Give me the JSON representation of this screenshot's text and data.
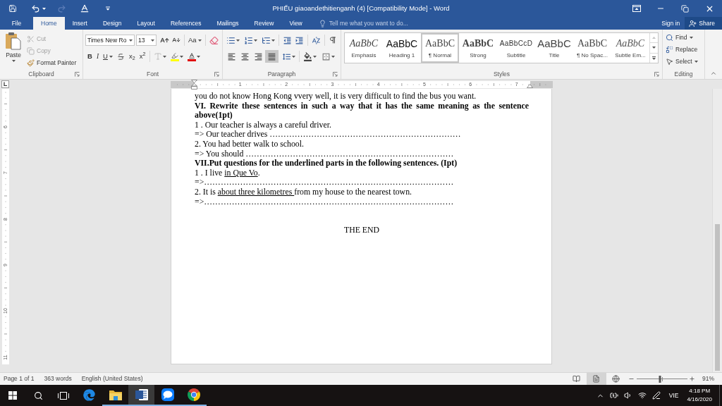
{
  "title_bar": {
    "title": "PHIẾU giaoandethitienganh (4) [Compatibility Mode] - Word",
    "quick_access": [
      {
        "kind": "save",
        "disabled": false
      },
      {
        "kind": "undo",
        "disabled": false
      },
      {
        "kind": "redo",
        "disabled": true
      },
      {
        "kind": "font_color",
        "disabled": false
      },
      {
        "kind": "customize",
        "disabled": false
      }
    ]
  },
  "tabs": [
    {
      "label": "File",
      "selected": false
    },
    {
      "label": "Home",
      "selected": true
    },
    {
      "label": "Insert",
      "selected": false
    },
    {
      "label": "Design",
      "selected": false
    },
    {
      "label": "Layout",
      "selected": false
    },
    {
      "label": "References",
      "selected": false
    },
    {
      "label": "Mailings",
      "selected": false
    },
    {
      "label": "Review",
      "selected": false
    },
    {
      "label": "View",
      "selected": false
    }
  ],
  "tell_me": {
    "placeholder": "Tell me what you want to do..."
  },
  "account": {
    "sign_in": "Sign in",
    "share": "Share"
  },
  "ribbon": {
    "clipboard": {
      "label": "Clipboard",
      "paste": "Paste",
      "items": [
        {
          "kind": "cut",
          "label": "Cut",
          "disabled": true
        },
        {
          "kind": "copy",
          "label": "Copy",
          "disabled": true
        },
        {
          "kind": "format_painter",
          "label": "Format Painter",
          "disabled": false
        }
      ]
    },
    "font": {
      "label": "Font",
      "font_name": "Times New Ro",
      "font_size": "13",
      "change_case": "Aa",
      "format_buttons": [
        {
          "kind": "bold",
          "label": "B"
        },
        {
          "kind": "italic",
          "label": "I"
        },
        {
          "kind": "underline",
          "label": "U"
        },
        {
          "kind": "strike"
        },
        {
          "kind": "subscript",
          "label": "x$_{2}$"
        },
        {
          "kind": "superscript",
          "label": "x$^{2}$"
        }
      ]
    },
    "paragraph": {
      "label": "Paragraph",
      "alignment": [
        {
          "kind": "left",
          "selected": false
        },
        {
          "kind": "center",
          "selected": false
        },
        {
          "kind": "right",
          "selected": false
        },
        {
          "kind": "justify",
          "selected": true
        }
      ]
    },
    "styles": {
      "label": "Styles",
      "items": [
        {
          "kind": "emphasis",
          "preview": "AaBbC",
          "name": "Emphasis",
          "selected": false
        },
        {
          "kind": "heading",
          "preview": "AaBbC",
          "name": "Heading 1",
          "selected": false
        },
        {
          "kind": "normal",
          "preview": "AaBbC",
          "name": "¶ Normal",
          "selected": true
        },
        {
          "kind": "strong",
          "preview": "AaBbC",
          "name": "Strong",
          "selected": false
        },
        {
          "kind": "subtitle",
          "preview": "AaBbCcD",
          "name": "Subtitle",
          "selected": false
        },
        {
          "kind": "title",
          "preview": "AaBbC",
          "name": "Title",
          "selected": false
        },
        {
          "kind": "no_spacing",
          "preview": "AaBbC",
          "name": "¶ No Spac...",
          "selected": false
        },
        {
          "kind": "subtle",
          "preview": "AaBbC",
          "name": "Subtle Em...",
          "selected": false
        }
      ]
    },
    "editing": {
      "label": "Editing",
      "items": [
        {
          "kind": "find",
          "label": "Find"
        },
        {
          "kind": "replace",
          "label": "Replace"
        },
        {
          "kind": "select",
          "label": "Select"
        }
      ]
    }
  },
  "ruler": {
    "numbers": [
      "1",
      "2",
      "3",
      "4",
      "5",
      "6",
      "7"
    ]
  },
  "vertical_ruler": {
    "numbers": [
      "6",
      "7",
      "8",
      "9",
      "10",
      "11"
    ]
  },
  "document": {
    "paragraphs": [
      {
        "kind": "body",
        "segments": [
          {
            "text": "you do not know Hong Kong vvery well, it is very difficult to find the bus you want.",
            "underlined": false
          }
        ]
      },
      {
        "kind": "heading",
        "segments": [
          {
            "text": "VI. Rewrite these sentences in such a way that it has the same meaning as the sentence above(1pt)",
            "underlined": false
          }
        ]
      },
      {
        "kind": "body",
        "segments": [
          {
            "text": "1 . Our teacher is always a careful driver.",
            "underlined": false
          }
        ]
      },
      {
        "kind": "body",
        "segments": [
          {
            "text": "=> Our teacher drives ……………………………………………………………",
            "underlined": false
          }
        ]
      },
      {
        "kind": "body",
        "segments": [
          {
            "text": "2. You had better walk to school.",
            "underlined": false
          }
        ]
      },
      {
        "kind": "body",
        "segments": [
          {
            "text": "=> You should …………………………………………………………………",
            "underlined": false
          }
        ]
      },
      {
        "kind": "heading",
        "segments": [
          {
            "text": "VII.Put questions for the underlined parts in the following sentences. (Ipt)",
            "underlined": false
          }
        ]
      },
      {
        "kind": "body",
        "segments": [
          {
            "text": "1 . I live ",
            "underlined": false
          },
          {
            "text": "in Que Vo",
            "underlined": true
          },
          {
            "text": ".",
            "underlined": false
          }
        ]
      },
      {
        "kind": "body",
        "segments": [
          {
            "text": "=>………………………………………………………………………………",
            "underlined": false
          }
        ]
      },
      {
        "kind": "body",
        "segments": [
          {
            "text": "2. It is ",
            "underlined": false
          },
          {
            "text": "about three kilometres ",
            "underlined": true
          },
          {
            "text": "from my house to the nearest town.",
            "underlined": false
          }
        ]
      },
      {
        "kind": "body",
        "segments": [
          {
            "text": "=>………………………………………………………………………………",
            "underlined": false
          }
        ]
      },
      {
        "kind": "centered",
        "segments": [
          {
            "text": "THE END",
            "underlined": false
          }
        ]
      }
    ]
  },
  "status_bar": {
    "page": "Page 1 of 1",
    "words": "363 words",
    "language": "English (United States)",
    "views": [
      {
        "kind": "read",
        "selected": false
      },
      {
        "kind": "print",
        "selected": true
      },
      {
        "kind": "web",
        "selected": false
      }
    ],
    "zoom": {
      "level": 0.46,
      "percent": "91%"
    }
  },
  "taskbar": {
    "apps": [
      {
        "kind": "edge",
        "running": false,
        "active": false
      },
      {
        "kind": "explorer",
        "running": true,
        "active": false
      },
      {
        "kind": "word",
        "running": true,
        "active": true
      },
      {
        "kind": "zalo",
        "running": true,
        "active": false
      },
      {
        "kind": "chrome",
        "running": true,
        "active": false
      }
    ],
    "tray": {
      "language": "VIE",
      "time": "4:18 PM",
      "date": "4/16/2020"
    }
  }
}
